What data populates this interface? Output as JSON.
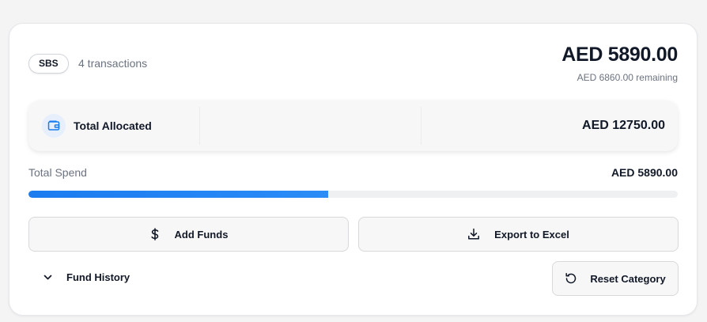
{
  "header": {
    "badge": "SBS",
    "transactions": "4 transactions",
    "amount": "AED 5890.00",
    "remaining": "AED 6860.00 remaining"
  },
  "allocated": {
    "icon": "wallet-icon",
    "label": "Total Allocated",
    "value": "AED 12750.00"
  },
  "spend": {
    "label": "Total Spend",
    "value": "AED 5890.00",
    "progress_fraction": 0.462,
    "bar_color": "#1a7cef"
  },
  "actions": {
    "add_funds": {
      "label": "Add Funds",
      "icon": "dollar-icon"
    },
    "export": {
      "label": "Export to Excel",
      "icon": "download-icon"
    },
    "history": {
      "label": "Fund History",
      "icon": "chevron-down-icon"
    },
    "reset": {
      "label": "Reset Category",
      "icon": "reset-icon"
    }
  },
  "colors": {
    "accent": "#1a7cef",
    "muted_text": "#6b7280",
    "wallet_bg": "#e6effb"
  }
}
